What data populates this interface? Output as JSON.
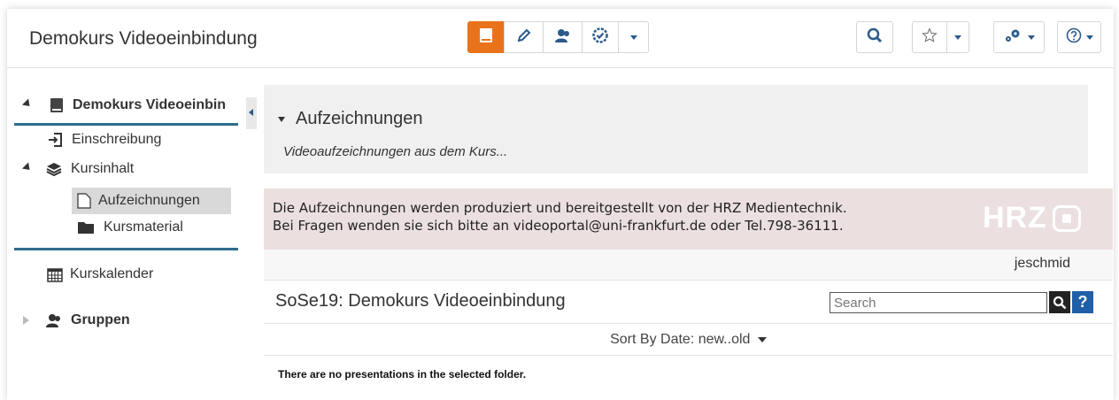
{
  "header": {
    "course_title": "Demokurs Videoeinbindung",
    "colors": {
      "accent": "#e9731b",
      "icon": "#2b5a8a"
    }
  },
  "sidebar": {
    "items": [
      {
        "label": "Demokurs Videoeinbindung",
        "icon": "book-icon"
      },
      {
        "label": "Einschreibung",
        "icon": "enroll-icon"
      },
      {
        "label": "Kursinhalt",
        "icon": "layers-icon"
      },
      {
        "label": "Aufzeichnungen",
        "icon": "page-icon"
      },
      {
        "label": "Kursmaterial",
        "icon": "folder-icon"
      },
      {
        "label": "Kurskalender",
        "icon": "calendar-icon"
      },
      {
        "label": "Gruppen",
        "icon": "group-icon"
      }
    ]
  },
  "main": {
    "section_title": "Aufzeichnungen",
    "section_desc": "Videoaufzeichnungen aus dem Kurs...",
    "info_line1": "Die Aufzeichnungen werden produziert und bereitgestellt von der HRZ Medientechnik.",
    "info_line2": "Bei Fragen wenden sie sich bitte an videoportal@uni-frankfurt.de oder Tel.798-36111.",
    "logo_text": "HRZ",
    "username": "jeschmid",
    "folder_title": "SoSe19: Demokurs Videoeinbindung",
    "search_placeholder": "Search",
    "help_label": "?",
    "sort_label": "Sort By Date: new..old",
    "empty_message": "There are no presentations in the selected folder."
  }
}
